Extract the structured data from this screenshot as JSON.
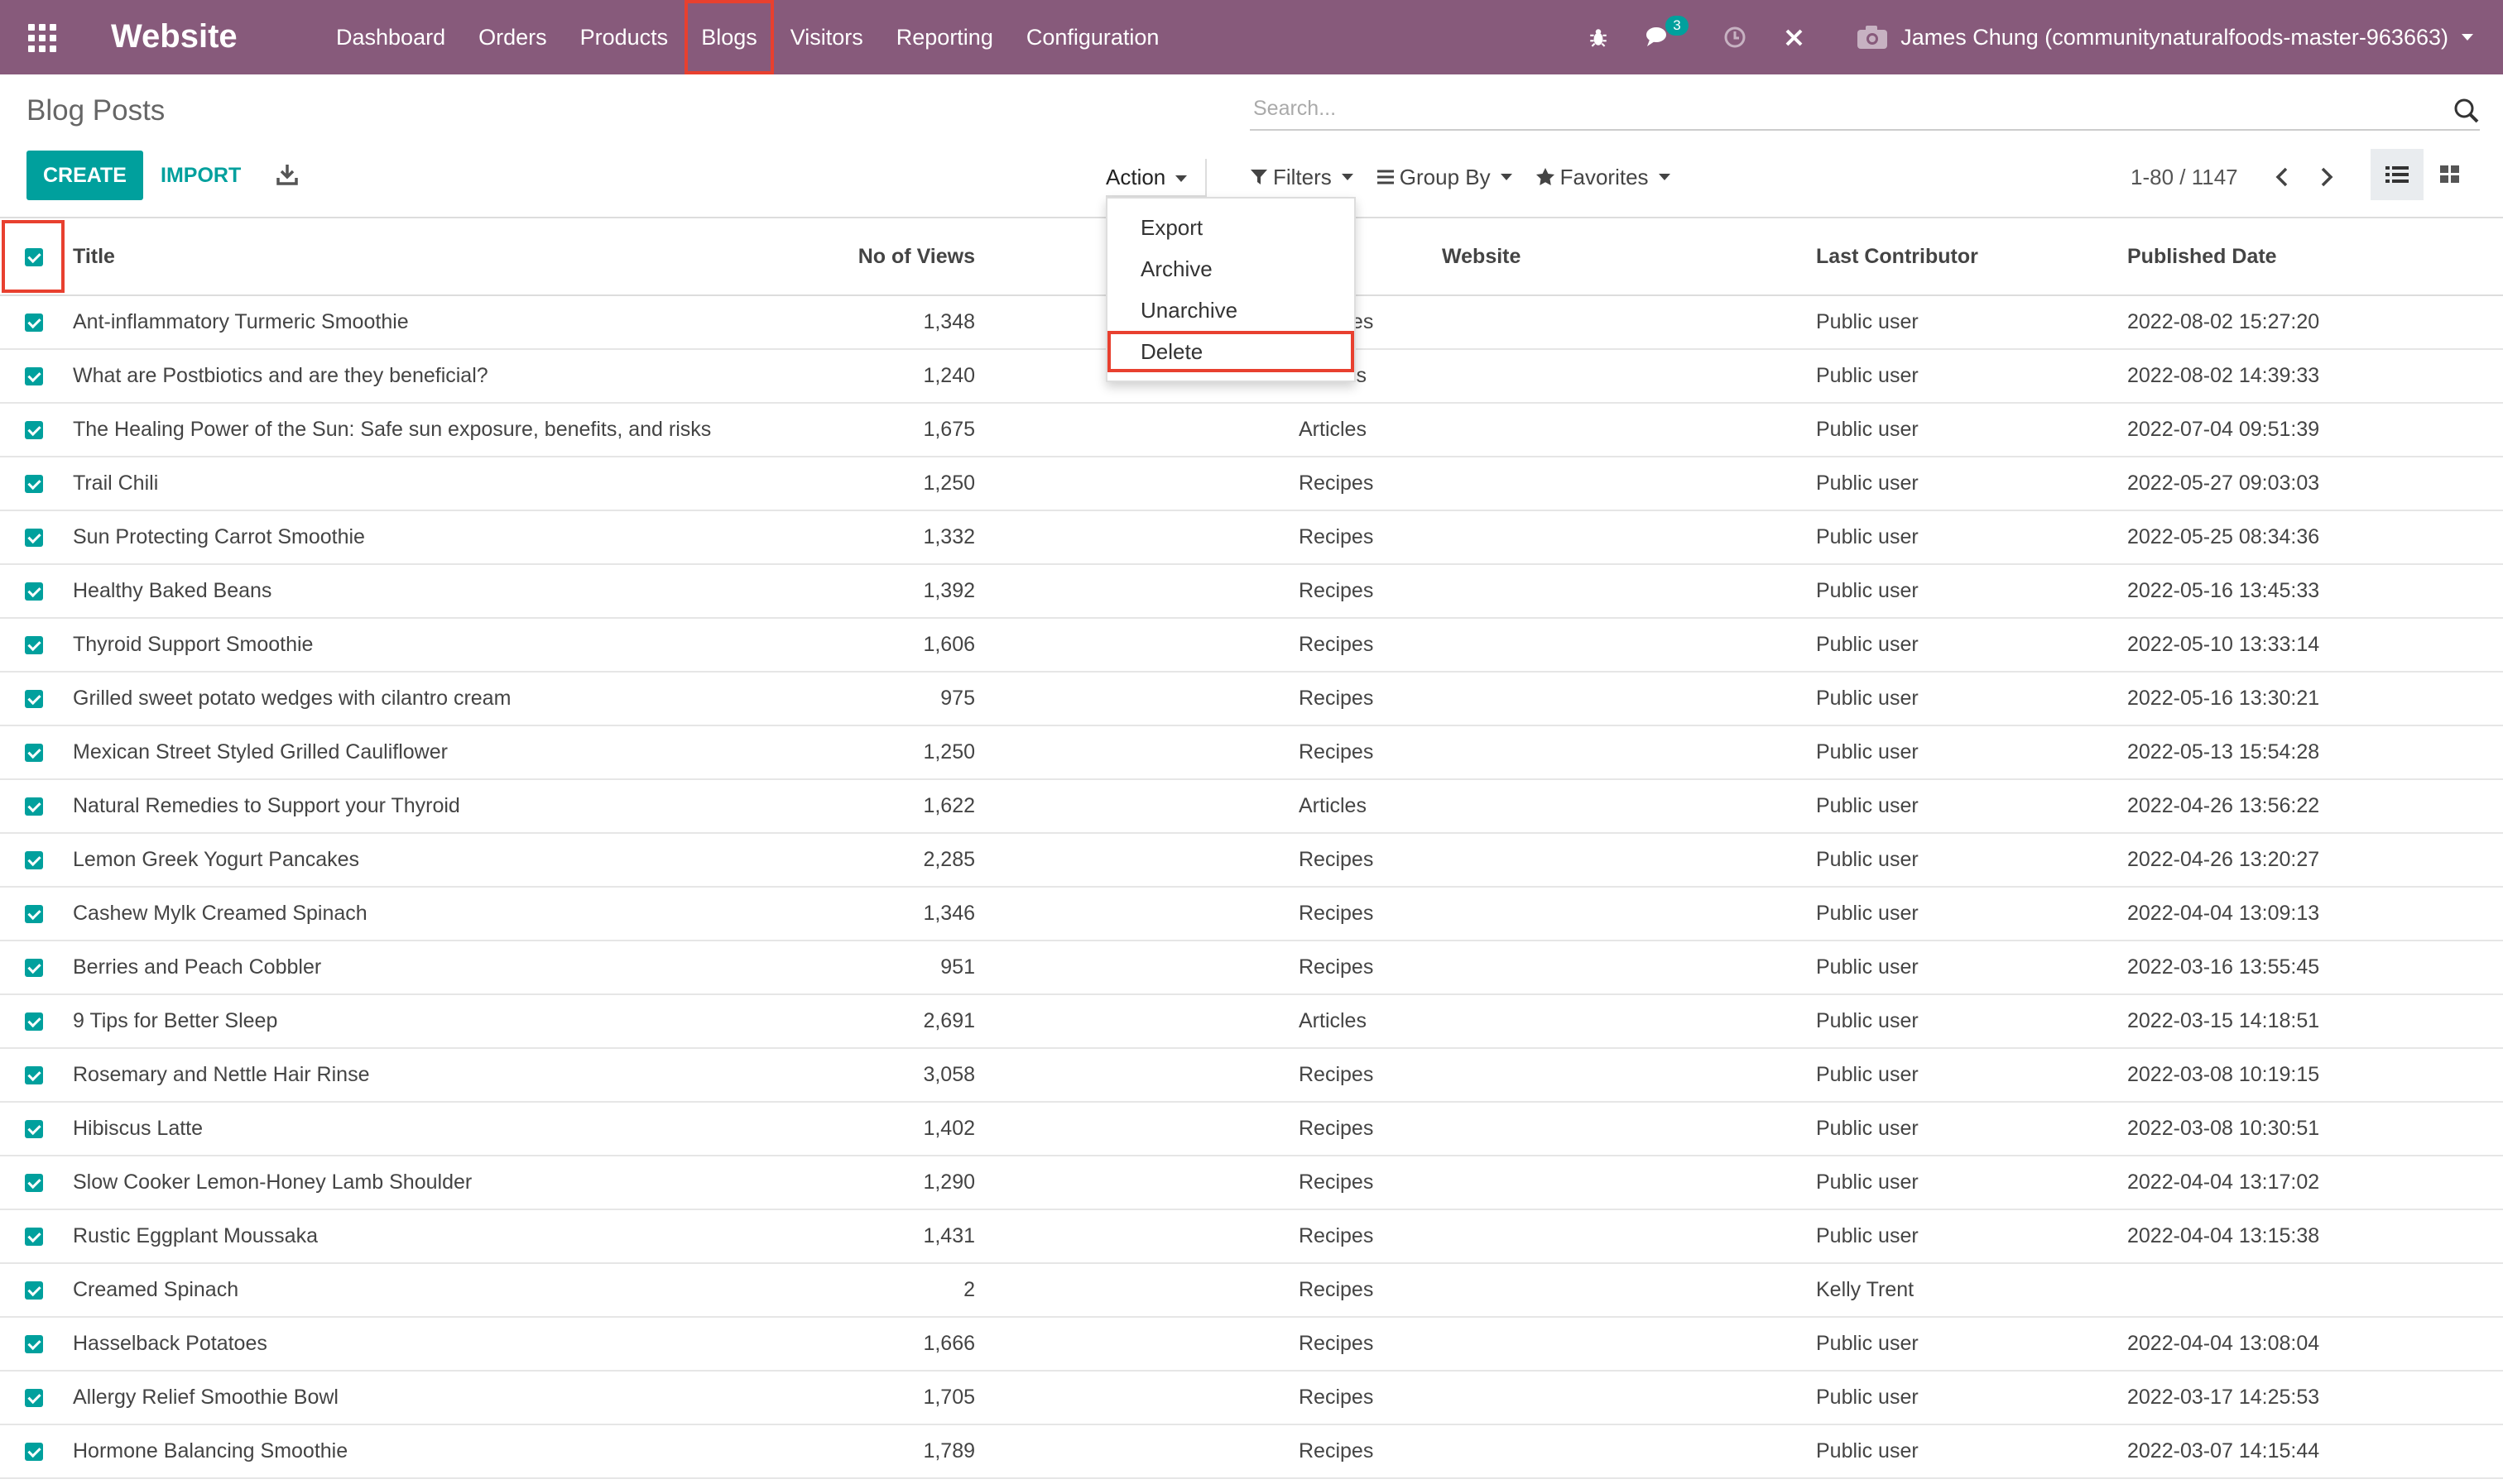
{
  "app": {
    "title": "Website",
    "menu": [
      "Dashboard",
      "Orders",
      "Products",
      "Blogs",
      "Visitors",
      "Reporting",
      "Configuration"
    ],
    "highlighted_menu": "Blogs",
    "systray": {
      "chat_count": "3",
      "user": "James Chung (communitynaturalfoods-master-963663)"
    }
  },
  "control_panel": {
    "breadcrumb": "Blog Posts",
    "search_placeholder": "Search...",
    "create_label": "CREATE",
    "import_label": "IMPORT",
    "action_label": "Action",
    "filters_label": "Filters",
    "groupby_label": "Group By",
    "favorites_label": "Favorites",
    "pager": "1-80 / 1147"
  },
  "action_menu": {
    "items": [
      "Export",
      "Archive",
      "Unarchive",
      "Delete"
    ],
    "highlighted": "Delete"
  },
  "table": {
    "columns": {
      "title": "Title",
      "blog": "",
      "website": "Website",
      "views": "No of Views",
      "contributor": "Last Contributor",
      "date": "Published Date"
    },
    "rows": [
      {
        "title": "Ant-inflammatory Turmeric Smoothie",
        "blog": "Recipes",
        "views": "1,348",
        "contributor": "Public user",
        "date": "2022-08-02 15:27:20"
      },
      {
        "title": "What are Postbiotics and are they beneficial?",
        "blog": "Articles",
        "views": "1,240",
        "contributor": "Public user",
        "date": "2022-08-02 14:39:33"
      },
      {
        "title": "The Healing Power of the Sun: Safe sun exposure, benefits, and risks",
        "blog": "Articles",
        "views": "1,675",
        "contributor": "Public user",
        "date": "2022-07-04 09:51:39"
      },
      {
        "title": "Trail Chili",
        "blog": "Recipes",
        "views": "1,250",
        "contributor": "Public user",
        "date": "2022-05-27 09:03:03"
      },
      {
        "title": "Sun Protecting Carrot Smoothie",
        "blog": "Recipes",
        "views": "1,332",
        "contributor": "Public user",
        "date": "2022-05-25 08:34:36"
      },
      {
        "title": "Healthy Baked Beans",
        "blog": "Recipes",
        "views": "1,392",
        "contributor": "Public user",
        "date": "2022-05-16 13:45:33"
      },
      {
        "title": "Thyroid Support Smoothie",
        "blog": "Recipes",
        "views": "1,606",
        "contributor": "Public user",
        "date": "2022-05-10 13:33:14"
      },
      {
        "title": "Grilled sweet potato wedges with cilantro cream",
        "blog": "Recipes",
        "views": "975",
        "contributor": "Public user",
        "date": "2022-05-16 13:30:21"
      },
      {
        "title": "Mexican Street Styled Grilled Cauliflower",
        "blog": "Recipes",
        "views": "1,250",
        "contributor": "Public user",
        "date": "2022-05-13 15:54:28"
      },
      {
        "title": "Natural Remedies to Support your Thyroid",
        "blog": "Articles",
        "views": "1,622",
        "contributor": "Public user",
        "date": "2022-04-26 13:56:22"
      },
      {
        "title": "Lemon Greek Yogurt Pancakes",
        "blog": "Recipes",
        "views": "2,285",
        "contributor": "Public user",
        "date": "2022-04-26 13:20:27"
      },
      {
        "title": "Cashew Mylk Creamed Spinach",
        "blog": "Recipes",
        "views": "1,346",
        "contributor": "Public user",
        "date": "2022-04-04 13:09:13"
      },
      {
        "title": "Berries and Peach Cobbler",
        "blog": "Recipes",
        "views": "951",
        "contributor": "Public user",
        "date": "2022-03-16 13:55:45"
      },
      {
        "title": "9 Tips for Better Sleep",
        "blog": "Articles",
        "views": "2,691",
        "contributor": "Public user",
        "date": "2022-03-15 14:18:51"
      },
      {
        "title": "Rosemary and Nettle Hair Rinse",
        "blog": "Recipes",
        "views": "3,058",
        "contributor": "Public user",
        "date": "2022-03-08 10:19:15"
      },
      {
        "title": "Hibiscus Latte",
        "blog": "Recipes",
        "views": "1,402",
        "contributor": "Public user",
        "date": "2022-03-08 10:30:51"
      },
      {
        "title": "Slow Cooker Lemon-Honey Lamb Shoulder",
        "blog": "Recipes",
        "views": "1,290",
        "contributor": "Public user",
        "date": "2022-04-04 13:17:02"
      },
      {
        "title": "Rustic Eggplant Moussaka",
        "blog": "Recipes",
        "views": "1,431",
        "contributor": "Public user",
        "date": "2022-04-04 13:15:38"
      },
      {
        "title": "Creamed Spinach",
        "blog": "Recipes",
        "views": "2",
        "contributor": "Kelly Trent",
        "date": ""
      },
      {
        "title": "Hasselback Potatoes",
        "blog": "Recipes",
        "views": "1,666",
        "contributor": "Public user",
        "date": "2022-04-04 13:08:04"
      },
      {
        "title": "Allergy Relief Smoothie Bowl",
        "blog": "Recipes",
        "views": "1,705",
        "contributor": "Public user",
        "date": "2022-03-17 14:25:53"
      },
      {
        "title": "Hormone Balancing Smoothie",
        "blog": "Recipes",
        "views": "1,789",
        "contributor": "Public user",
        "date": "2022-03-07 14:15:44"
      }
    ]
  },
  "colors": {
    "navbar": "#875a7b",
    "accent": "#00a09d",
    "highlight_box": "#e8402f"
  }
}
